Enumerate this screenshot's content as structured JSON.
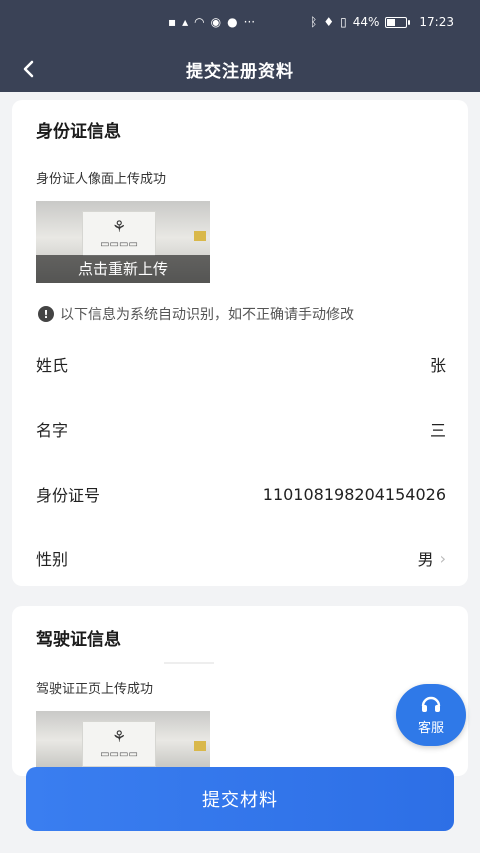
{
  "status_bar": {
    "left_icons": [
      "hd-icon",
      "signal-icon",
      "wifi-icon",
      "notification-icon",
      "chat-icon",
      "ellipsis-icon"
    ],
    "battery_percent": 44,
    "battery_text": "44%",
    "time": "17:23"
  },
  "navbar": {
    "title": "提交注册资料"
  },
  "id_card": {
    "title": "身份证信息",
    "upload_status": "身份证人像面上传成功",
    "reupload_label": "点击重新上传",
    "notice": "以下信息为系统自动识别，如不正确请手动修改",
    "fields": [
      {
        "label": "姓氏",
        "value": "张"
      },
      {
        "label": "名字",
        "value": "三"
      },
      {
        "label": "身份证号",
        "value": "110108198204154026"
      },
      {
        "label": "性别",
        "value": "男"
      }
    ]
  },
  "license": {
    "title": "驾驶证信息",
    "upload_status": "驾驶证正页上传成功"
  },
  "service_button": {
    "label": "客服"
  },
  "submit_button": {
    "label": "提交材料"
  },
  "colors": {
    "header": "#3a4256",
    "primary": "#2f79e8"
  }
}
